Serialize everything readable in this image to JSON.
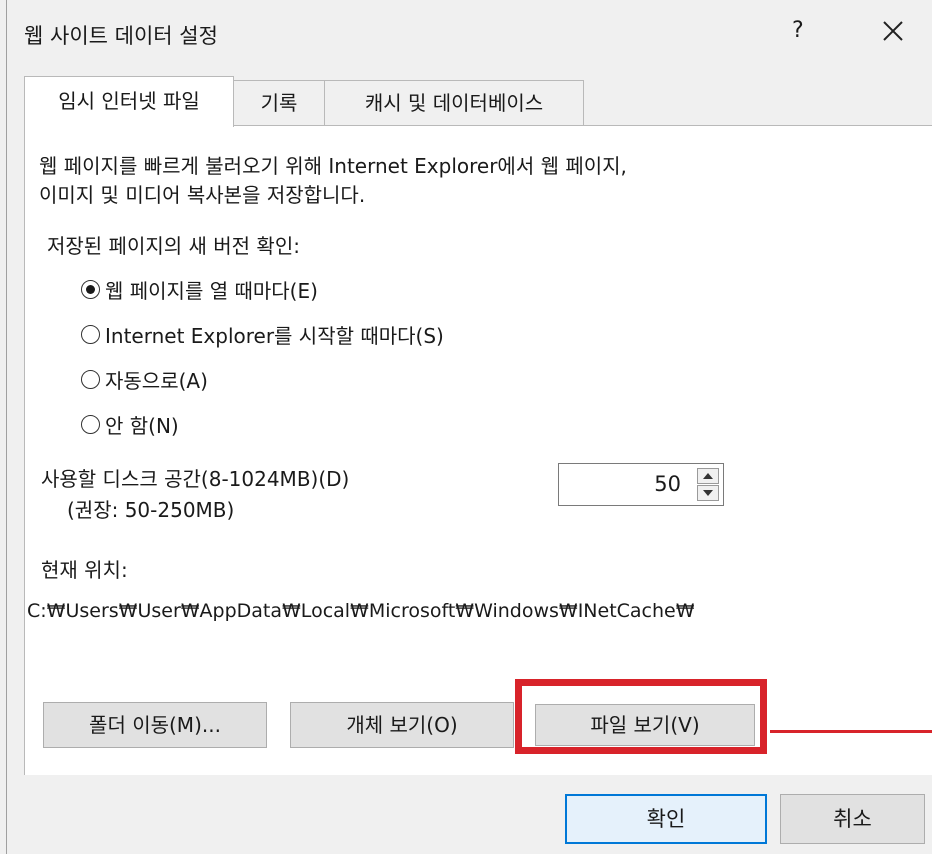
{
  "dialog": {
    "title": "웹 사이트 데이터 설정",
    "help_label": "?"
  },
  "tabs": [
    {
      "label": "임시 인터넷 파일",
      "active": true
    },
    {
      "label": "기록",
      "active": false
    },
    {
      "label": "캐시 및 데이터베이스",
      "active": false
    }
  ],
  "temp_files": {
    "description_line1": "웹 페이지를 빠르게 불러오기 위해 Internet Explorer에서 웹 페이지,",
    "description_line2": "이미지 및 미디어 복사본을 저장합니다.",
    "check_label": "저장된 페이지의 새 버전 확인:",
    "options": [
      {
        "label": "웹 페이지를 열 때마다(E)",
        "selected": true
      },
      {
        "label": "Internet Explorer를 시작할 때마다(S)",
        "selected": false
      },
      {
        "label": "자동으로(A)",
        "selected": false
      },
      {
        "label": "안 함(N)",
        "selected": false
      }
    ],
    "disk_label": "사용할 디스크 공간(8-1024MB)(D)",
    "disk_hint": "(권장: 50-250MB)",
    "disk_value": "50",
    "location_label": "현재 위치:",
    "location_path": "C:₩Users₩User₩AppData₩Local₩Microsoft₩Windows₩INetCache₩",
    "buttons": {
      "move_folder": "폴더 이동(M)...",
      "view_objects": "개체 보기(O)",
      "view_files": "파일 보기(V)"
    }
  },
  "footer": {
    "ok": "확인",
    "cancel": "취소"
  },
  "colors": {
    "highlight": "#d8232a",
    "ok_border": "#0078d7"
  },
  "icons": {
    "close": "close-icon",
    "spin_up": "triangle-up-icon",
    "spin_down": "triangle-down-icon"
  }
}
